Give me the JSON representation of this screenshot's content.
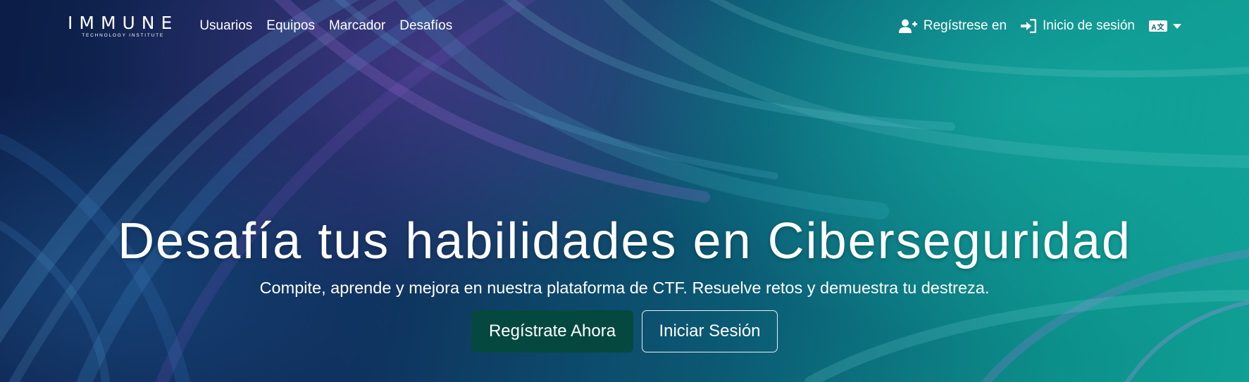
{
  "brand": {
    "name": "IMMUNE",
    "tagline": "TECHNOLOGY INSTITUTE"
  },
  "nav": {
    "links": [
      {
        "label": "Usuarios"
      },
      {
        "label": "Equipos"
      },
      {
        "label": "Marcador"
      },
      {
        "label": "Desafíos"
      }
    ],
    "register_label": "Regístrese en",
    "register_icon": "user-plus-icon",
    "login_label": "Inicio de sesión",
    "login_icon": "sign-in-icon",
    "language_icon": "language-icon",
    "language_badge": "A文"
  },
  "hero": {
    "title": "Desafía tus habilidades en Ciberseguridad",
    "subtitle": "Compite, aprende y mejora en nuestra plataforma de CTF. Resuelve retos y demuestra tu destreza.",
    "primary_button": "Regístrate Ahora",
    "secondary_button": "Iniciar Sesión"
  },
  "colors": {
    "primary_button_bg": "#054840",
    "text": "#ffffff",
    "bg_dark": "#0c1d47",
    "bg_teal": "#109f95"
  }
}
